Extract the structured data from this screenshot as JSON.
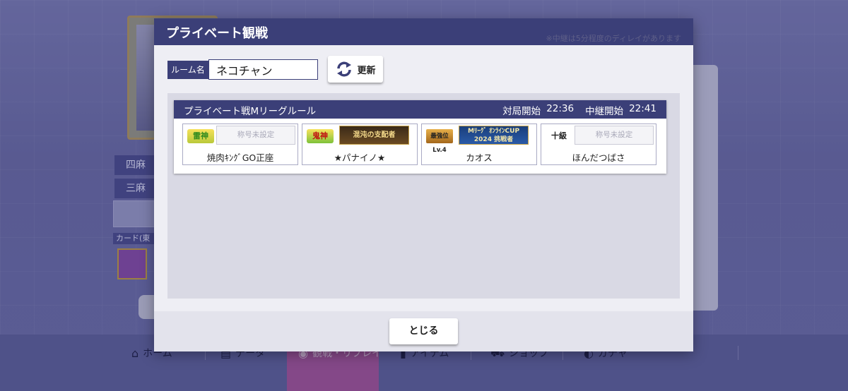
{
  "background": {
    "mode_labels": [
      "四麻",
      "三麻"
    ],
    "card_label": "カード(東",
    "nav": [
      {
        "icon": "home-icon",
        "label": "ホーム"
      },
      {
        "icon": "data-icon",
        "label": "データ"
      },
      {
        "icon": "watch-icon",
        "label": "観戦・リプレイ"
      },
      {
        "icon": "item-icon",
        "label": "アイテム"
      },
      {
        "icon": "shop-icon",
        "label": "ショップ"
      },
      {
        "icon": "gacha-icon",
        "label": "ガチャ"
      }
    ]
  },
  "modal": {
    "title": "プライベート観戦",
    "note": "※中継は5分程度のディレイがあります",
    "room_label": "ルーム名",
    "room_name": "ネコチャン",
    "refresh_label": "更新",
    "close_label": "とじる"
  },
  "match": {
    "rule": "プライベート戦Mリーグルール",
    "start_label": "対局開始",
    "start_time": "22:36",
    "relay_label": "中継開始",
    "relay_time": "22:41",
    "players": [
      {
        "rank": "雷神",
        "title": "称号未設定",
        "title_set": false,
        "name": "焼肉ｷﾝｸﾞGO正座"
      },
      {
        "rank": "鬼神",
        "title": "混沌の支配者",
        "title_set": true,
        "name": "★パナイノ★"
      },
      {
        "rank": "最強位Lv.4",
        "title": "Mﾘｰｸﾞ ｵﾝﾗｲﾝCUP 2024 挑戦者",
        "title_set": true,
        "name": "カオス"
      },
      {
        "rank": "十級",
        "title": "称号未設定",
        "title_set": false,
        "name": "ほんだつばさ"
      }
    ]
  },
  "colors": {
    "header": "#3b3f78",
    "modal_bg": "#eeeef4",
    "list_bg": "#d9d9e4"
  }
}
